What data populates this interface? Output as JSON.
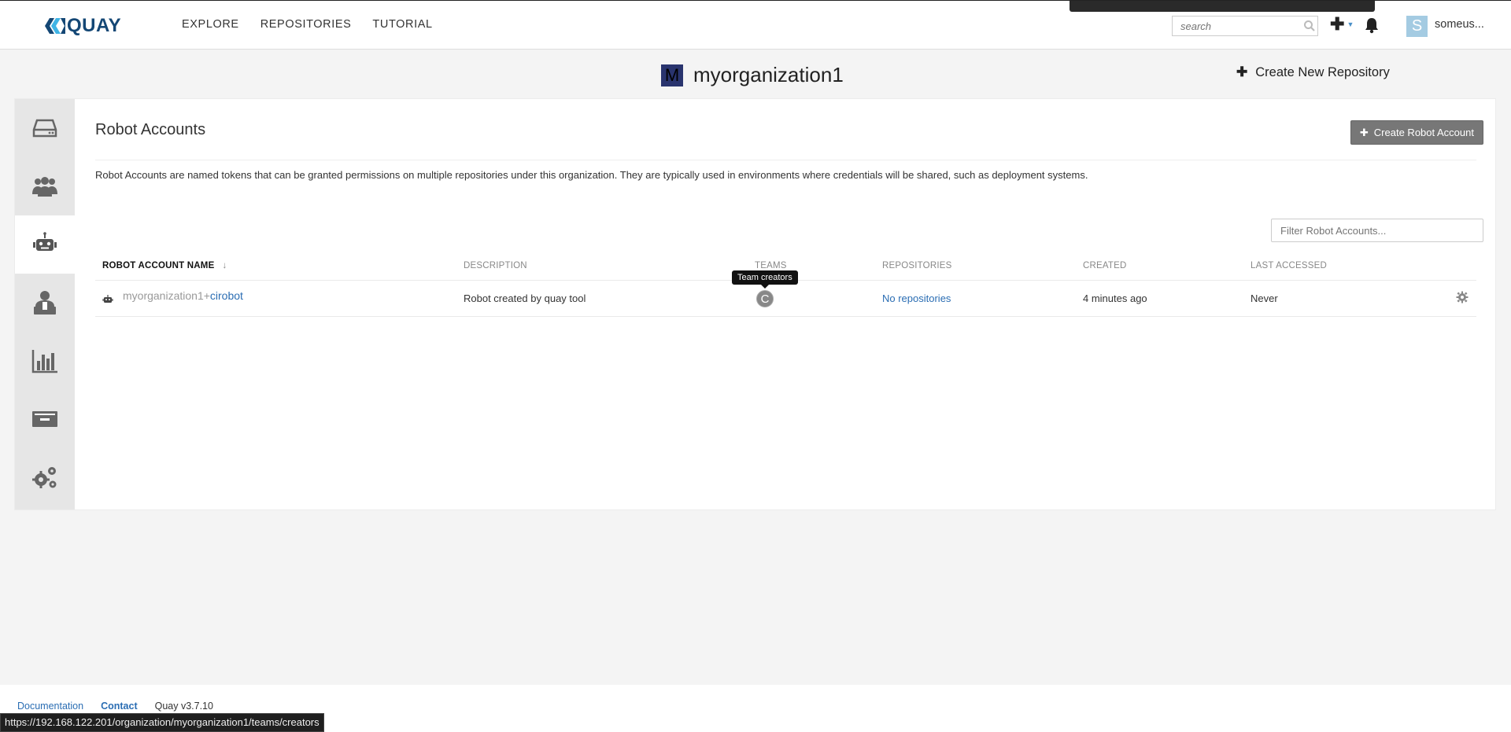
{
  "header": {
    "logo_text": "QUAY",
    "nav": [
      "EXPLORE",
      "REPOSITORIES",
      "TUTORIAL"
    ],
    "search_placeholder": "search",
    "user_initial": "S",
    "user_name": "someus..."
  },
  "org": {
    "avatar_letter": "M",
    "name": "myorganization1",
    "create_repo_label": "Create New Repository"
  },
  "sidebar": {
    "items": [
      "repositories-icon",
      "teams-icon",
      "robot-icon",
      "default-permissions-icon",
      "usage-logs-icon",
      "billing-icon",
      "settings-icon"
    ],
    "active_index": 2
  },
  "robots": {
    "title": "Robot Accounts",
    "create_label": "Create Robot Account",
    "description": "Robot Accounts are named tokens that can be granted permissions on multiple repositories under this organization. They are typically used in environments where credentials will be shared, such as deployment systems.",
    "filter_placeholder": "Filter Robot Accounts...",
    "columns": [
      "ROBOT ACCOUNT NAME",
      "DESCRIPTION",
      "TEAMS",
      "REPOSITORIES",
      "CREATED",
      "LAST ACCESSED"
    ],
    "sort_arrow": "↓",
    "rows": [
      {
        "prefix": "myorganization1+",
        "short_name": "cirobot",
        "description": "Robot created by quay tool",
        "team_initial": "C",
        "team_tooltip": "Team creators",
        "repositories": "No repositories",
        "created": "4 minutes ago",
        "last_accessed": "Never"
      }
    ]
  },
  "footer": {
    "documentation": "Documentation",
    "contact": "Contact",
    "version": "Quay v3.7.10"
  },
  "status_url": "https://192.168.122.201/organization/myorganization1/teams/creators"
}
